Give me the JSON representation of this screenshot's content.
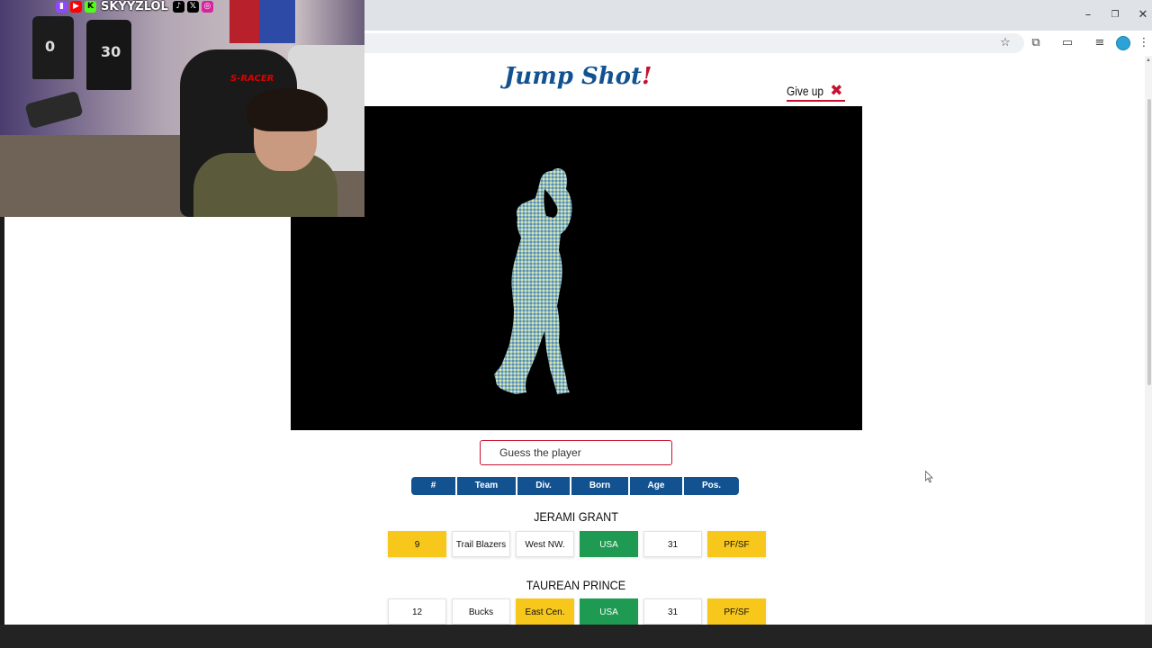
{
  "browser": {
    "window_controls": {
      "minimize": "–",
      "restore": "❐",
      "close": "✕"
    },
    "toolbar_icons": [
      "star-icon",
      "extensions-icon",
      "cast-icon",
      "media-icon",
      "profile-icon",
      "menu-icon"
    ]
  },
  "stream_overlay": {
    "handle": "SKYYZLOL",
    "social_icons": [
      "twitch-icon",
      "youtube-icon",
      "kick-icon",
      "tiktok-icon",
      "x-icon",
      "instagram-icon"
    ],
    "chair_brand": "S-RACER",
    "shirt_numbers": [
      "0",
      "30"
    ]
  },
  "game": {
    "title_main": "Jump Shot",
    "title_bang": "!",
    "give_up_label": "Give up",
    "guess_placeholder": "Guess the player",
    "column_headers": [
      "#",
      "Team",
      "Div.",
      "Born",
      "Age",
      "Pos."
    ],
    "guesses": [
      {
        "name": "JERAMI GRANT",
        "cells": [
          {
            "value": "9",
            "status": "yellow"
          },
          {
            "value": "Trail Blazers",
            "status": "none"
          },
          {
            "value": "West NW.",
            "status": "none"
          },
          {
            "value": "USA",
            "status": "green"
          },
          {
            "value": "31",
            "status": "none"
          },
          {
            "value": "PF/SF",
            "status": "yellow"
          }
        ]
      },
      {
        "name": "TAUREAN PRINCE",
        "cells": [
          {
            "value": "12",
            "status": "none"
          },
          {
            "value": "Bucks",
            "status": "none"
          },
          {
            "value": "East Cen.",
            "status": "yellow"
          },
          {
            "value": "USA",
            "status": "green"
          },
          {
            "value": "31",
            "status": "none"
          },
          {
            "value": "PF/SF",
            "status": "yellow"
          }
        ]
      }
    ]
  },
  "colors": {
    "brand_blue": "#125291",
    "brand_red": "#c8102e",
    "match_green": "#1f9a52",
    "partial_yellow": "#f7c71c"
  }
}
